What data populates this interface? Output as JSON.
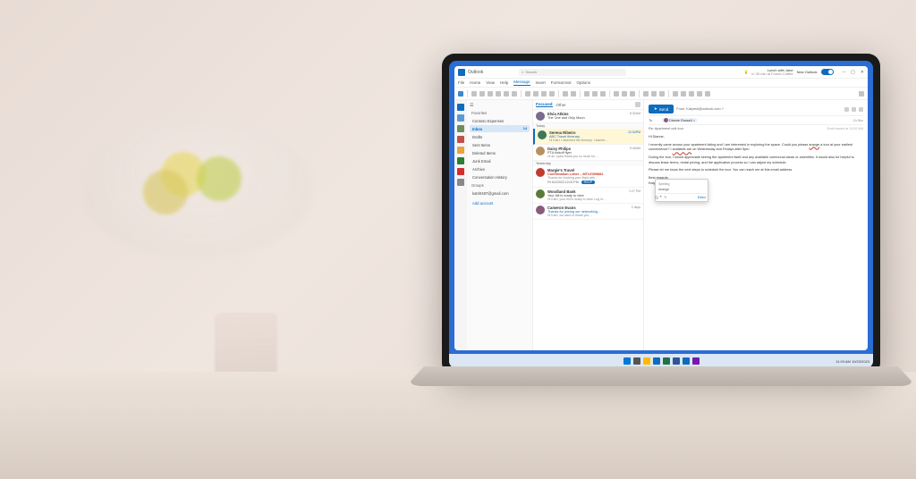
{
  "app": {
    "name": "Outlook",
    "search_placeholder": "Search"
  },
  "titlebar": {
    "meeting_hint": "Lunch with Jane",
    "meeting_time": "in 30 min at Fourth Coffee",
    "new_outlook": "New Outlook"
  },
  "ribbon_tabs": [
    "File",
    "Home",
    "View",
    "Help",
    "Message",
    "Insert",
    "Format text",
    "Options"
  ],
  "ribbon_active": "Message",
  "sidebar": {
    "favorites": "Favorites",
    "fav_items": [
      {
        "label": "Contoso Expenses"
      },
      {
        "label": "Inbox",
        "count": "14",
        "selected": true
      },
      {
        "label": "Drafts"
      },
      {
        "label": "Sent Items"
      },
      {
        "label": "Deleted Items"
      },
      {
        "label": "Junk Email"
      },
      {
        "label": "Archive"
      },
      {
        "label": "Conversation History"
      }
    ],
    "groups": "Groups",
    "account": "katri0487@gmail.com",
    "add": "Add account"
  },
  "msglist": {
    "tabs": {
      "focused": "Focused",
      "other": "Other"
    },
    "sections": {
      "pinned": "",
      "today": "Today",
      "yesterday": "Yesterday"
    },
    "items": [
      {
        "from": "Elvia Atkins",
        "subject": "The One and Only Moon",
        "time": "8:32AM",
        "avatar": "#7a6b8f"
      },
      {
        "from": "Serena Ribeiro",
        "subject": "ABC Travel Itinerary",
        "preview": "Hi Katri, I attached the itinerary. I started…",
        "time": "12:04PM",
        "avatar": "#3a7a5a",
        "selected": true,
        "subjBlue": true
      },
      {
        "from": "Daisy Philips",
        "subject": "PTA kickoff flyer",
        "preview": "Hi all, Lydia thank you so much for…",
        "time": "9:45AM",
        "avatar": "#b89060"
      },
      {
        "from": "Margie's Travel",
        "subject": "Confirmation Letter – MTLE399882",
        "preview": "Thanks for booking your flight with…",
        "time": "",
        "avatar": "#c43a2e",
        "subjRed": true,
        "rsvp": {
          "date": "Fri 6/2/2023 12:00 PM",
          "btn": "RSVP"
        }
      },
      {
        "from": "Woodland Bank",
        "subject": "Your bill is ready to view",
        "preview": "Hi Katri, your bill is ready to view. Log in…",
        "time": "1:27 PM",
        "avatar": "#5a7a3a"
      },
      {
        "from": "Cameron Evans",
        "subject": "Thanks for joining our networking…",
        "preview": "Hi Katri, we want to thank you…",
        "time": "2 days",
        "avatar": "#8a5a7a",
        "subjBlue": true
      }
    ]
  },
  "compose": {
    "send": "Send",
    "from_label": "From:",
    "from_value": "Katyreid@outlook.com",
    "to_label": "To",
    "to_chip": "Dianne Russell",
    "cc_hint": "Cc   Bcc",
    "subject_label": "Re: Apartment unit tour",
    "draft_hint": "Draft saved at 11:02 AM",
    "greeting": "Hi Dianne,",
    "para1a": "I recently came across your apartment listing and I am interested in exploring the space. Could you please ",
    "para1_err": "arange",
    "para1b": " a tour at your earliest convenience? I ",
    "para1_err2": "available are",
    "para1c": " on Wednesday and Fridays after 5pm.",
    "para2a": "During the tour, I would appreciate seeing the apartment itself and any available communal areas or amenities. It would also be helpful to discuss lease terms, rental pricing, and the application process so I can ",
    "para2_trail": "adjust my schedule.",
    "para3": "Please let me know the next steps to schedule the tour. You can reach me at this email address.",
    "signoff": "Best regards,",
    "signature": "Katy Reid",
    "popup": {
      "heading": "Spelling",
      "suggest": "arrange",
      "editor": "Editor"
    }
  },
  "taskbar": {
    "time": "11:03 AM",
    "date": "10/23/2023"
  }
}
